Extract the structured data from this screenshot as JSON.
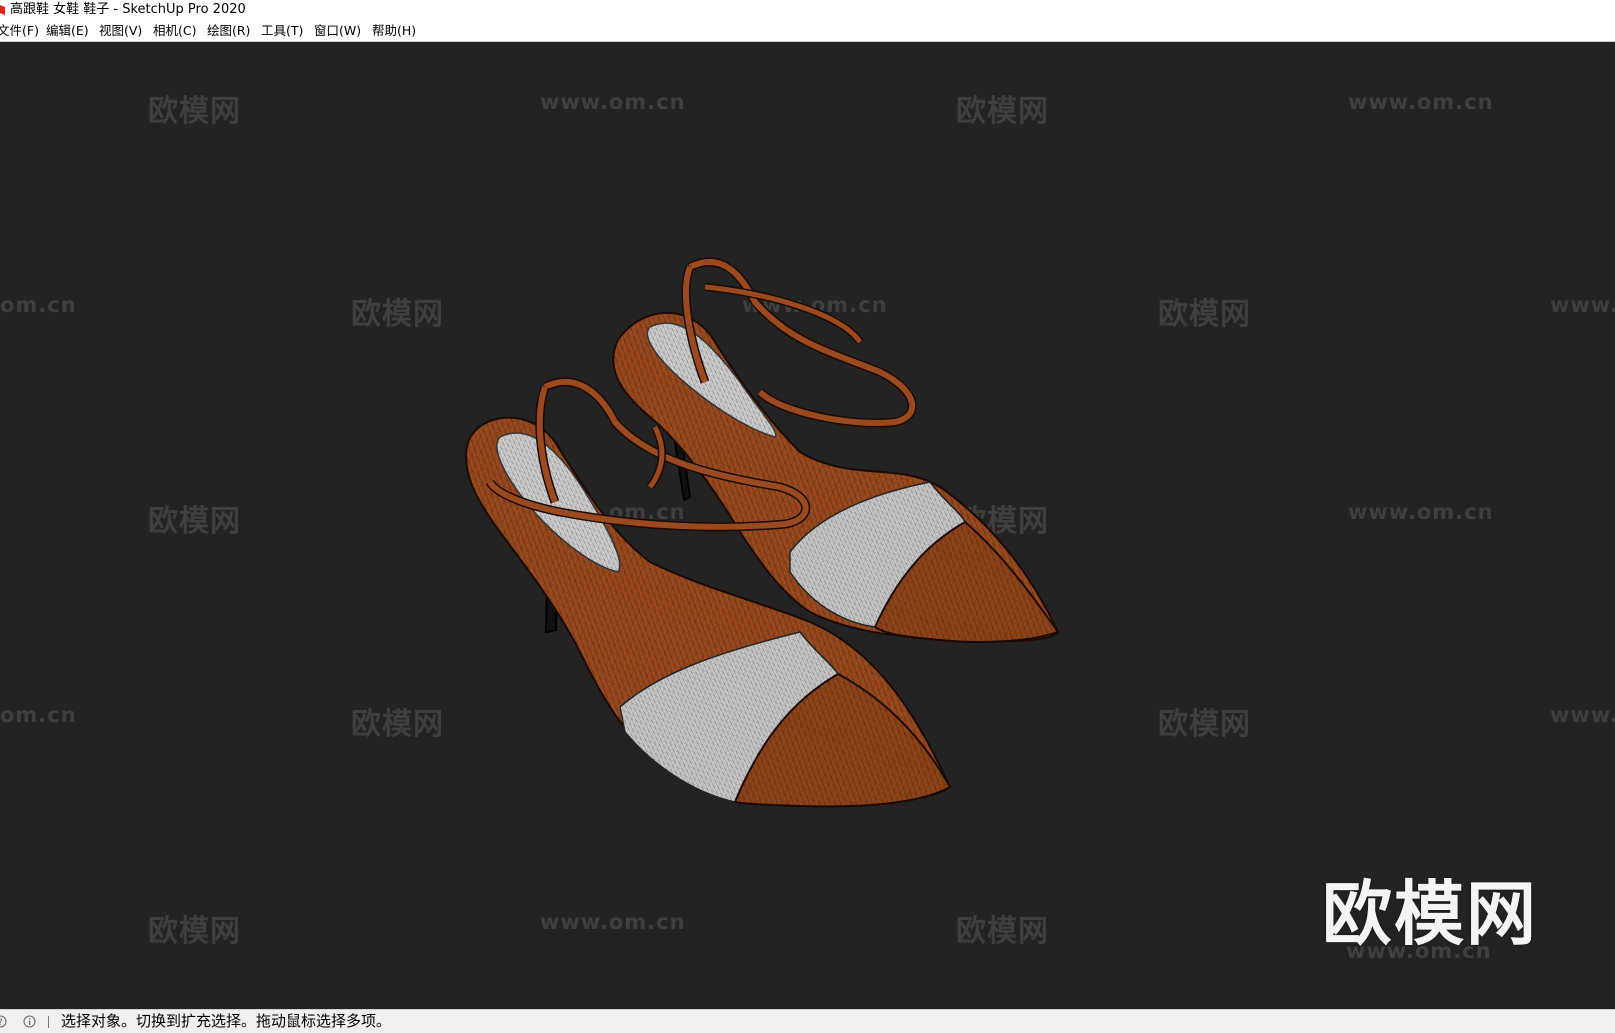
{
  "window": {
    "title": "高跟鞋 女鞋 鞋子 - SketchUp Pro 2020",
    "app_icon": "sketchup-logo-icon"
  },
  "menu": [
    {
      "label": "文件(F)"
    },
    {
      "label": "编辑(E)"
    },
    {
      "label": "视图(V)"
    },
    {
      "label": "相机(C)"
    },
    {
      "label": "绘图(R)"
    },
    {
      "label": "工具(T)"
    },
    {
      "label": "窗口(W)"
    },
    {
      "label": "帮助(H)"
    }
  ],
  "watermark": {
    "brand": "欧模网",
    "url": "www.om.cn",
    "url_partial_left": "om.cn",
    "url_partial_right": "www."
  },
  "status": {
    "icons": [
      "help-icon",
      "info-icon"
    ],
    "text": "选择对象。切换到扩充选择。拖动鼠标选择多项。"
  },
  "colors": {
    "viewport_bg": "#232323",
    "shoe_leather": "#9a4a1e",
    "shoe_lining": "#cfcfcf",
    "watermark": "#3f3f3f"
  }
}
